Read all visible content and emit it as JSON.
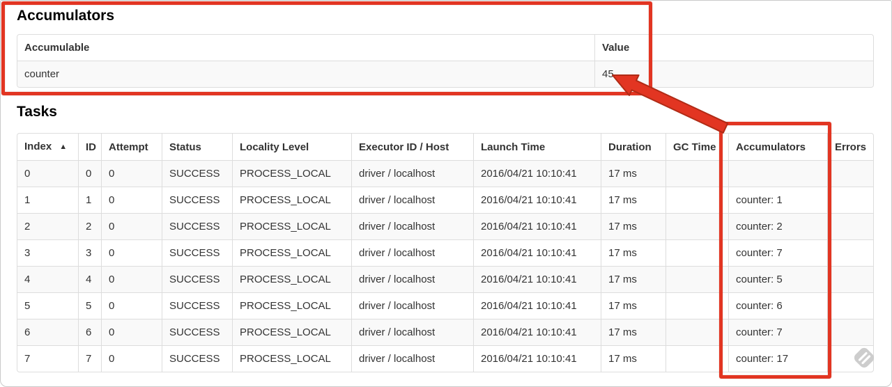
{
  "accumulators_section": {
    "title": "Accumulators",
    "table": {
      "col_accumulable": "Accumulable",
      "col_value": "Value",
      "rows": [
        {
          "accumulable": "counter",
          "value": "45"
        }
      ]
    }
  },
  "tasks_section": {
    "title": "Tasks",
    "table": {
      "headers": [
        "Index",
        "ID",
        "Attempt",
        "Status",
        "Locality Level",
        "Executor ID / Host",
        "Launch Time",
        "Duration",
        "GC Time",
        "Accumulators",
        "Errors"
      ],
      "sort_indicator": "▲",
      "rows": [
        {
          "index": "0",
          "id": "0",
          "attempt": "0",
          "status": "SUCCESS",
          "locality_level": "PROCESS_LOCAL",
          "executor_id_host": "driver / localhost",
          "launch_time": "2016/04/21 10:10:41",
          "duration": "17 ms",
          "gc_time": "",
          "accumulators": "",
          "errors": ""
        },
        {
          "index": "1",
          "id": "1",
          "attempt": "0",
          "status": "SUCCESS",
          "locality_level": "PROCESS_LOCAL",
          "executor_id_host": "driver / localhost",
          "launch_time": "2016/04/21 10:10:41",
          "duration": "17 ms",
          "gc_time": "",
          "accumulators": "counter: 1",
          "errors": ""
        },
        {
          "index": "2",
          "id": "2",
          "attempt": "0",
          "status": "SUCCESS",
          "locality_level": "PROCESS_LOCAL",
          "executor_id_host": "driver / localhost",
          "launch_time": "2016/04/21 10:10:41",
          "duration": "17 ms",
          "gc_time": "",
          "accumulators": "counter: 2",
          "errors": ""
        },
        {
          "index": "3",
          "id": "3",
          "attempt": "0",
          "status": "SUCCESS",
          "locality_level": "PROCESS_LOCAL",
          "executor_id_host": "driver / localhost",
          "launch_time": "2016/04/21 10:10:41",
          "duration": "17 ms",
          "gc_time": "",
          "accumulators": "counter: 7",
          "errors": ""
        },
        {
          "index": "4",
          "id": "4",
          "attempt": "0",
          "status": "SUCCESS",
          "locality_level": "PROCESS_LOCAL",
          "executor_id_host": "driver / localhost",
          "launch_time": "2016/04/21 10:10:41",
          "duration": "17 ms",
          "gc_time": "",
          "accumulators": "counter: 5",
          "errors": ""
        },
        {
          "index": "5",
          "id": "5",
          "attempt": "0",
          "status": "SUCCESS",
          "locality_level": "PROCESS_LOCAL",
          "executor_id_host": "driver / localhost",
          "launch_time": "2016/04/21 10:10:41",
          "duration": "17 ms",
          "gc_time": "",
          "accumulators": "counter: 6",
          "errors": ""
        },
        {
          "index": "6",
          "id": "6",
          "attempt": "0",
          "status": "SUCCESS",
          "locality_level": "PROCESS_LOCAL",
          "executor_id_host": "driver / localhost",
          "launch_time": "2016/04/21 10:10:41",
          "duration": "17 ms",
          "gc_time": "",
          "accumulators": "counter: 7",
          "errors": ""
        },
        {
          "index": "7",
          "id": "7",
          "attempt": "0",
          "status": "SUCCESS",
          "locality_level": "PROCESS_LOCAL",
          "executor_id_host": "driver / localhost",
          "launch_time": "2016/04/21 10:10:41",
          "duration": "17 ms",
          "gc_time": "",
          "accumulators": "counter: 17",
          "errors": ""
        }
      ]
    }
  },
  "annotations": {
    "highlight_color": "#e23522",
    "accumulators_box": "around Accumulators summary table",
    "column_box": "around Accumulators task column",
    "arrow": "points from Accumulators column to value 45"
  }
}
